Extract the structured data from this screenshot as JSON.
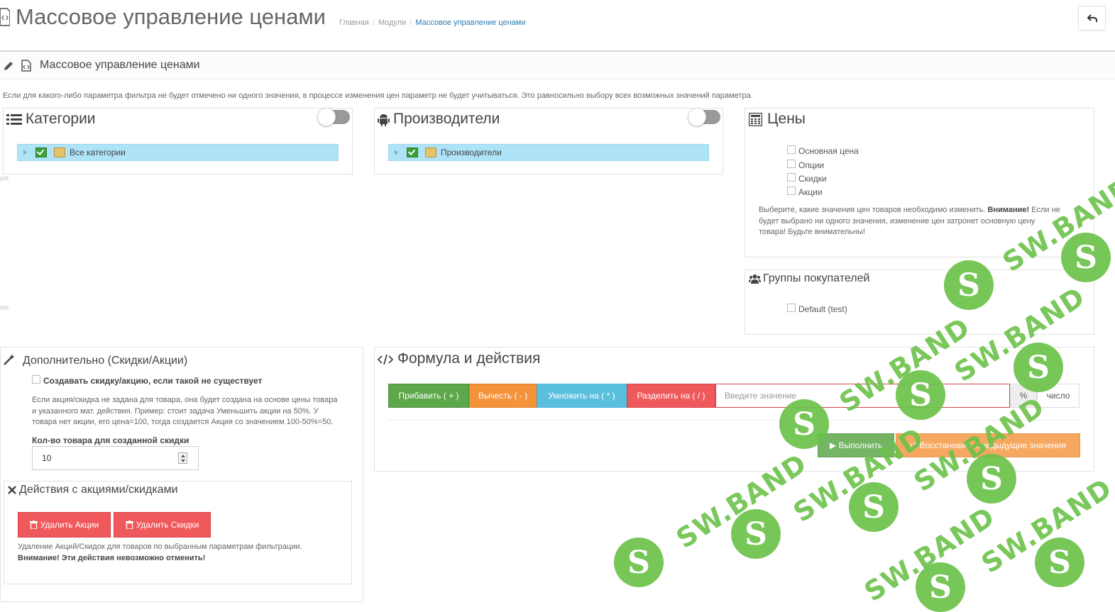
{
  "header": {
    "title": "Массовое управление ценами",
    "breadcrumb": [
      "Главная",
      "Модули",
      "Массовое управление ценами"
    ],
    "back_icon": "undo-icon"
  },
  "panel": {
    "title": "Массовое управление ценами",
    "info": "Если для какого-либо параметра фильтра не будет отмечено ни одного значения, в процессе изменения цен параметр не будет учитываться. Это равносильно выбору всех возможных значений параметра."
  },
  "categories": {
    "title": "Категории",
    "tree_item": "Все категории",
    "side_fragment": "ия"
  },
  "manufacturers": {
    "title": "Производители",
    "tree_item": "Производители",
    "side_fragment": "ии"
  },
  "prices": {
    "title": "Цены",
    "options": [
      "Основная цена",
      "Опции",
      "Скидки",
      "Акции"
    ],
    "help_prefix": "Выберите, какие значения цен товаров необходимо изменить.",
    "help_bold": "Внимание!",
    "help_suffix_1": "Если не",
    "help_suffix_2": "будет выбрано ни одного значения, изменение цен затронет основную цену",
    "help_suffix_3": "товара! Будьте внимательны!"
  },
  "customer_groups": {
    "title": "Группы покупателей",
    "options": [
      "Default (test)"
    ]
  },
  "extra": {
    "title": "Дополнительно (Скидки/Акции)",
    "create_label": "Создавать скидку/акцию, если такой не существует",
    "help_1": "Если акция/скидка не задана для товара, она будет создана на основе цены товара",
    "help_2": "и указанного мат. действия. Пример: стоит задача Уменьшить акции на 50%. У",
    "help_3": "товара нет акции, его цена=100, тогда создается Акция со значением 100-50%=50.",
    "qty_label": "Кол-во товара для созданной скидки",
    "qty_value": "10"
  },
  "actions": {
    "title": "Действия с акциями/скидками",
    "delete_specials": "Удалить Акции",
    "delete_discounts": "Удалить Скидки",
    "help": "Удаление Акций/Скидок для товаров по выбранным параметрам фильтрации.",
    "warning": "Внимание! Эти действия невозможно отменить!"
  },
  "formula": {
    "title": "Формула и действия",
    "add": "Прибавить ( + )",
    "subtract": "Вычесть ( - )",
    "multiply": "Умножить на ( * )",
    "divide": "Разделить на ( / )",
    "input_placeholder": "Введите значение",
    "percent": "%",
    "number": "число",
    "execute": "▶ Выполнить",
    "restore": "↺ Восстановить предыдущие значения"
  },
  "watermark": {
    "text": "SW.BAND",
    "logo_letter": "S"
  },
  "colors": {
    "green": "#5da84a",
    "orange": "#f4933a",
    "blue": "#5bc0de",
    "red": "#f0595c",
    "link": "#2a7bb5",
    "tree_bg": "#aee3f8",
    "watermark": "#6cc24a"
  }
}
